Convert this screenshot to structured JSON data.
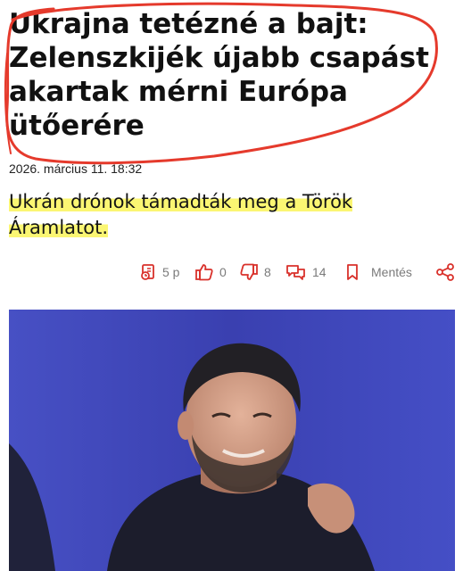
{
  "article": {
    "headline_lines": [
      "Ukrajna tetézné a bajt:",
      "Zelenszkijék újabb csapást",
      "akartak mérni Európa",
      "ütőerére"
    ],
    "date_prefix": "2026.",
    "date_rest": " március 11. 18:32",
    "lead_lines": [
      "Ukrán drónok támadták meg a Török",
      "Áramlatot."
    ]
  },
  "actions": {
    "read_time": "5 p",
    "likes": "0",
    "dislikes": "8",
    "comments": "14",
    "save_label": "Mentés"
  },
  "icons": {
    "read_time": "read-time-icon",
    "like": "thumbs-up-icon",
    "dislike": "thumbs-down-icon",
    "comments": "comments-icon",
    "save": "bookmark-icon",
    "share": "share-icon"
  },
  "colors": {
    "accent": "#d9312b",
    "annotation_circle": "#e53a2c",
    "highlighter": "#f7f25a",
    "photo_background": "#3d44b8"
  }
}
